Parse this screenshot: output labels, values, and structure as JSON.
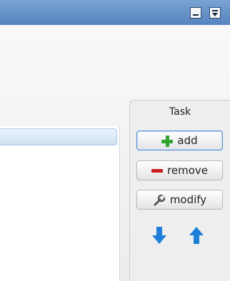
{
  "task": {
    "title": "Task",
    "add_label": "add",
    "remove_label": "remove",
    "modify_label": "modify"
  },
  "icons": {
    "add": "plus-icon",
    "remove": "minus-icon",
    "modify": "wrench-icon",
    "move_down": "arrow-down-icon",
    "move_up": "arrow-up-icon",
    "window_min": "minimize-icon",
    "window_menu": "menu-dropdown-icon"
  },
  "colors": {
    "titlebar": "#5f8cc4",
    "add_green": "#2ea32e",
    "remove_red": "#c81e1e",
    "arrow_blue": "#1e7fd8"
  }
}
